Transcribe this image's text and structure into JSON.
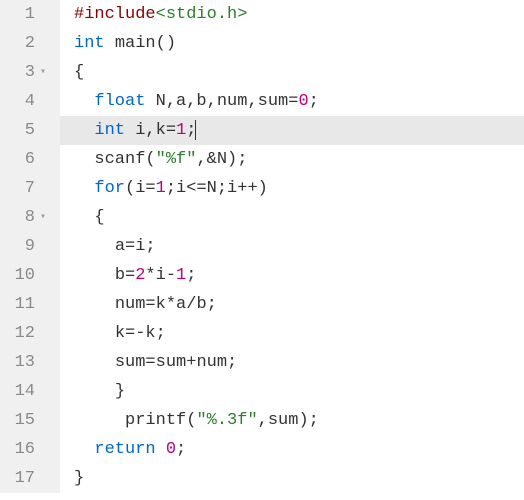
{
  "language": "c",
  "highlighted_line": 5,
  "lines": [
    {
      "n": "1",
      "fold": false,
      "indent": 0,
      "tokens": [
        {
          "cls": "tok-pp",
          "t": "#include"
        },
        {
          "cls": "tok-inc",
          "t": "<stdio.h>"
        }
      ]
    },
    {
      "n": "2",
      "fold": false,
      "indent": 0,
      "tokens": [
        {
          "cls": "tok-kw",
          "t": "int"
        },
        {
          "cls": "tok-pn",
          "t": " "
        },
        {
          "cls": "tok-fn",
          "t": "main"
        },
        {
          "cls": "tok-pn",
          "t": "()"
        }
      ]
    },
    {
      "n": "3",
      "fold": true,
      "indent": 0,
      "tokens": [
        {
          "cls": "tok-pn",
          "t": "{"
        }
      ]
    },
    {
      "n": "4",
      "fold": false,
      "indent": 1,
      "tokens": [
        {
          "cls": "tok-kw",
          "t": "float"
        },
        {
          "cls": "tok-id",
          "t": " N,a,b,num,sum"
        },
        {
          "cls": "tok-op",
          "t": "="
        },
        {
          "cls": "tok-num",
          "t": "0"
        },
        {
          "cls": "tok-pn",
          "t": ";"
        }
      ]
    },
    {
      "n": "5",
      "fold": false,
      "indent": 1,
      "tokens": [
        {
          "cls": "tok-kw",
          "t": "int"
        },
        {
          "cls": "tok-id",
          "t": " i,k"
        },
        {
          "cls": "tok-op",
          "t": "="
        },
        {
          "cls": "tok-num",
          "t": "1"
        },
        {
          "cls": "tok-pn",
          "t": ";"
        }
      ],
      "cursor_after": true
    },
    {
      "n": "6",
      "fold": false,
      "indent": 1,
      "tokens": [
        {
          "cls": "tok-fn",
          "t": "scanf"
        },
        {
          "cls": "tok-pn",
          "t": "("
        },
        {
          "cls": "tok-str",
          "t": "\"%f\""
        },
        {
          "cls": "tok-pn",
          "t": ",&N);"
        }
      ]
    },
    {
      "n": "7",
      "fold": false,
      "indent": 1,
      "tokens": [
        {
          "cls": "tok-kw",
          "t": "for"
        },
        {
          "cls": "tok-pn",
          "t": "(i"
        },
        {
          "cls": "tok-op",
          "t": "="
        },
        {
          "cls": "tok-num",
          "t": "1"
        },
        {
          "cls": "tok-pn",
          "t": ";i"
        },
        {
          "cls": "tok-op",
          "t": "<="
        },
        {
          "cls": "tok-pn",
          "t": "N;i"
        },
        {
          "cls": "tok-op",
          "t": "++"
        },
        {
          "cls": "tok-pn",
          "t": ")"
        }
      ]
    },
    {
      "n": "8",
      "fold": true,
      "indent": 1,
      "tokens": [
        {
          "cls": "tok-pn",
          "t": "{"
        }
      ]
    },
    {
      "n": "9",
      "fold": false,
      "indent": 2,
      "tokens": [
        {
          "cls": "tok-id",
          "t": "a"
        },
        {
          "cls": "tok-op",
          "t": "="
        },
        {
          "cls": "tok-id",
          "t": "i;"
        }
      ]
    },
    {
      "n": "10",
      "fold": false,
      "indent": 2,
      "tokens": [
        {
          "cls": "tok-id",
          "t": "b"
        },
        {
          "cls": "tok-op",
          "t": "="
        },
        {
          "cls": "tok-num",
          "t": "2"
        },
        {
          "cls": "tok-op",
          "t": "*"
        },
        {
          "cls": "tok-id",
          "t": "i"
        },
        {
          "cls": "tok-op",
          "t": "-"
        },
        {
          "cls": "tok-num",
          "t": "1"
        },
        {
          "cls": "tok-pn",
          "t": ";"
        }
      ]
    },
    {
      "n": "11",
      "fold": false,
      "indent": 2,
      "tokens": [
        {
          "cls": "tok-id",
          "t": "num"
        },
        {
          "cls": "tok-op",
          "t": "="
        },
        {
          "cls": "tok-id",
          "t": "k"
        },
        {
          "cls": "tok-op",
          "t": "*"
        },
        {
          "cls": "tok-id",
          "t": "a"
        },
        {
          "cls": "tok-op",
          "t": "/"
        },
        {
          "cls": "tok-id",
          "t": "b;"
        }
      ]
    },
    {
      "n": "12",
      "fold": false,
      "indent": 2,
      "tokens": [
        {
          "cls": "tok-id",
          "t": "k"
        },
        {
          "cls": "tok-op",
          "t": "=-"
        },
        {
          "cls": "tok-id",
          "t": "k;"
        }
      ]
    },
    {
      "n": "13",
      "fold": false,
      "indent": 2,
      "tokens": [
        {
          "cls": "tok-id",
          "t": "sum"
        },
        {
          "cls": "tok-op",
          "t": "="
        },
        {
          "cls": "tok-id",
          "t": "sum"
        },
        {
          "cls": "tok-op",
          "t": "+"
        },
        {
          "cls": "tok-id",
          "t": "num;"
        }
      ]
    },
    {
      "n": "14",
      "fold": false,
      "indent": 2,
      "tokens": [
        {
          "cls": "tok-pn",
          "t": "}"
        }
      ]
    },
    {
      "n": "15",
      "fold": false,
      "indent": 2,
      "tokens": [
        {
          "cls": "tok-pn",
          "t": " "
        },
        {
          "cls": "tok-fn",
          "t": "printf"
        },
        {
          "cls": "tok-pn",
          "t": "("
        },
        {
          "cls": "tok-str",
          "t": "\"%.3f\""
        },
        {
          "cls": "tok-pn",
          "t": ",sum);"
        }
      ]
    },
    {
      "n": "16",
      "fold": false,
      "indent": 1,
      "tokens": [
        {
          "cls": "tok-kw",
          "t": "return"
        },
        {
          "cls": "tok-pn",
          "t": " "
        },
        {
          "cls": "tok-num",
          "t": "0"
        },
        {
          "cls": "tok-pn",
          "t": ";"
        }
      ]
    },
    {
      "n": "17",
      "fold": false,
      "indent": 0,
      "tokens": [
        {
          "cls": "tok-pn",
          "t": "}"
        }
      ]
    }
  ]
}
